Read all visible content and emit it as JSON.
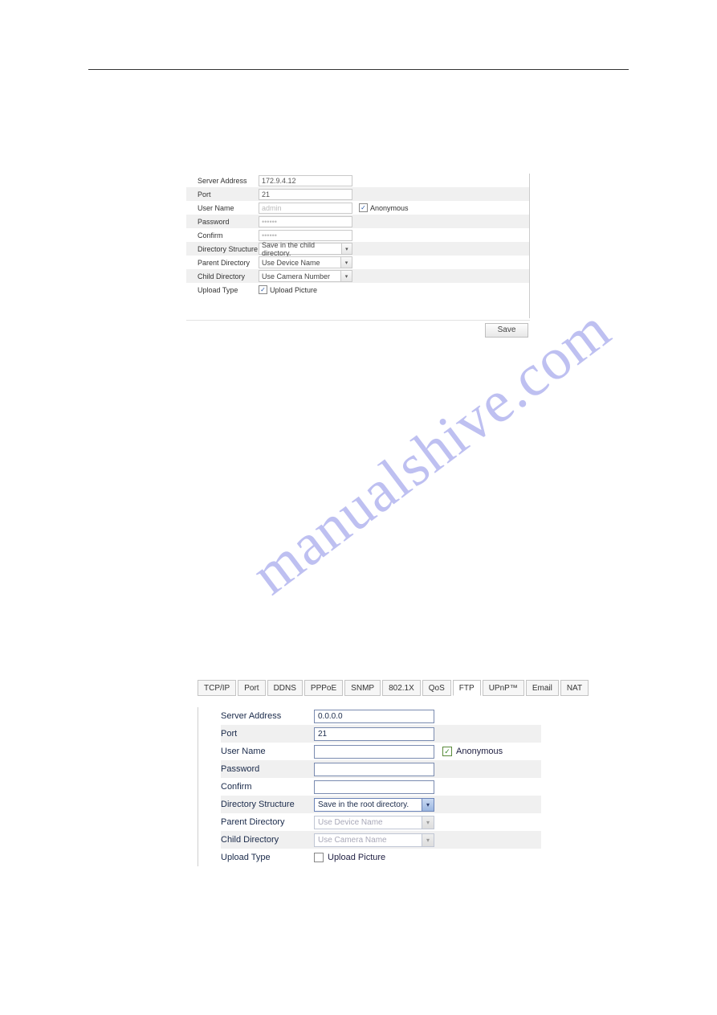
{
  "watermark": "manualshive.com",
  "panel1": {
    "rows": {
      "server_address": {
        "label": "Server Address",
        "value": "172.9.4.12"
      },
      "port": {
        "label": "Port",
        "value": "21"
      },
      "user_name": {
        "label": "User Name",
        "value": "admin"
      },
      "password": {
        "label": "Password",
        "value": "••••••"
      },
      "confirm": {
        "label": "Confirm",
        "value": "••••••"
      },
      "dir_structure": {
        "label": "Directory Structure",
        "value": "Save in the child directory."
      },
      "parent_dir": {
        "label": "Parent Directory",
        "value": "Use Device Name"
      },
      "child_dir": {
        "label": "Child Directory",
        "value": "Use Camera Number"
      },
      "upload_type": {
        "label": "Upload Type",
        "option": "Upload Picture"
      }
    },
    "anonymous_label": "Anonymous",
    "save_label": "Save"
  },
  "panel2": {
    "tabs": [
      "TCP/IP",
      "Port",
      "DDNS",
      "PPPoE",
      "SNMP",
      "802.1X",
      "QoS",
      "FTP",
      "UPnP™",
      "Email",
      "NAT"
    ],
    "active_tab": "FTP",
    "rows": {
      "server_address": {
        "label": "Server Address",
        "value": "0.0.0.0"
      },
      "port": {
        "label": "Port",
        "value": "21"
      },
      "user_name": {
        "label": "User Name",
        "value": ""
      },
      "password": {
        "label": "Password",
        "value": ""
      },
      "confirm": {
        "label": "Confirm",
        "value": ""
      },
      "dir_structure": {
        "label": "Directory Structure",
        "value": "Save in the root directory."
      },
      "parent_dir": {
        "label": "Parent Directory",
        "value": "Use Device Name"
      },
      "child_dir": {
        "label": "Child Directory",
        "value": "Use Camera Name"
      },
      "upload_type": {
        "label": "Upload Type",
        "option": "Upload Picture"
      }
    },
    "anonymous_label": "Anonymous"
  }
}
